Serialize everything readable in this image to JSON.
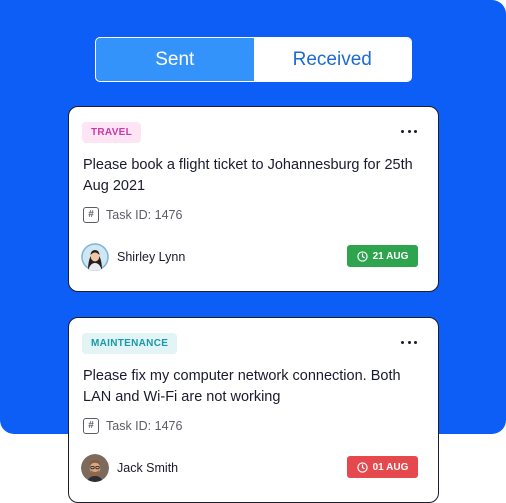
{
  "toggle": {
    "tabs": [
      {
        "label": "Sent",
        "active": false
      },
      {
        "label": "Received",
        "active": true
      }
    ]
  },
  "tasks": [
    {
      "tag": "TRAVEL",
      "title": "Please book a flight ticket to Johannesburg for 25th Aug 2021",
      "task_id": "Task ID: 1476",
      "user": "Shirley Lynn",
      "date": "21 AUG",
      "date_color": "#2ea44f",
      "tag_color": "#c83aa6",
      "icons": [
        "more-icon",
        "hash-icon",
        "clock-icon"
      ]
    },
    {
      "tag": "MAINTENANCE",
      "title": "Please fix my computer network connection. Both LAN and Wi-Fi are not working",
      "task_id": "Task ID: 1476",
      "user": "Jack Smith",
      "date": "01 AUG",
      "date_color": "#e5484d",
      "tag_color": "#1a9aa7",
      "icons": [
        "more-icon",
        "hash-icon",
        "clock-icon"
      ]
    }
  ],
  "colors": {
    "panel": "#0d5ef6",
    "toggle_inactive": "#3493fb",
    "toggle_active_text": "#1c6bd1"
  }
}
